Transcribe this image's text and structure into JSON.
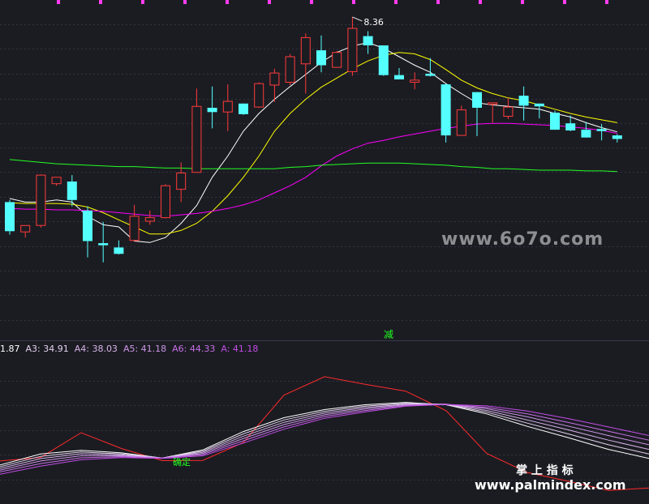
{
  "chart_data": [
    {
      "type": "candlestick",
      "title": "",
      "ylim": [
        3.8,
        8.6
      ],
      "grid": true,
      "high_label": "8.36",
      "signal_label": "减",
      "candles": [
        {
          "o": 5.75,
          "h": 5.78,
          "l": 5.29,
          "c": 5.34
        },
        {
          "o": 5.33,
          "h": 5.42,
          "l": 5.25,
          "c": 5.42
        },
        {
          "o": 5.42,
          "h": 6.14,
          "l": 5.39,
          "c": 6.13
        },
        {
          "o": 6.01,
          "h": 6.1,
          "l": 5.98,
          "c": 6.1
        },
        {
          "o": 6.04,
          "h": 6.13,
          "l": 5.69,
          "c": 5.78
        },
        {
          "o": 5.63,
          "h": 5.69,
          "l": 4.97,
          "c": 5.2
        },
        {
          "o": 5.17,
          "h": 5.47,
          "l": 4.9,
          "c": 5.14
        },
        {
          "o": 5.11,
          "h": 5.21,
          "l": 5.01,
          "c": 5.02
        },
        {
          "o": 5.21,
          "h": 5.71,
          "l": 5.2,
          "c": 5.55
        },
        {
          "o": 5.48,
          "h": 5.63,
          "l": 5.43,
          "c": 5.53
        },
        {
          "o": 5.53,
          "h": 6.0,
          "l": 5.52,
          "c": 5.98
        },
        {
          "o": 5.93,
          "h": 6.31,
          "l": 5.75,
          "c": 6.16
        },
        {
          "o": 6.17,
          "h": 7.35,
          "l": 6.17,
          "c": 7.1
        },
        {
          "o": 7.08,
          "h": 7.38,
          "l": 6.79,
          "c": 7.02
        },
        {
          "o": 7.02,
          "h": 7.41,
          "l": 6.75,
          "c": 7.17
        },
        {
          "o": 7.14,
          "h": 7.13,
          "l": 6.98,
          "c": 6.99
        },
        {
          "o": 7.09,
          "h": 7.44,
          "l": 7.08,
          "c": 7.42
        },
        {
          "o": 7.4,
          "h": 7.63,
          "l": 7.16,
          "c": 7.57
        },
        {
          "o": 7.44,
          "h": 7.84,
          "l": 7.4,
          "c": 7.8
        },
        {
          "o": 7.7,
          "h": 8.13,
          "l": 7.28,
          "c": 8.07
        },
        {
          "o": 7.89,
          "h": 8.1,
          "l": 7.58,
          "c": 7.68
        },
        {
          "o": 7.65,
          "h": 7.88,
          "l": 7.65,
          "c": 7.86
        },
        {
          "o": 7.59,
          "h": 8.36,
          "l": 7.53,
          "c": 8.2
        },
        {
          "o": 8.09,
          "h": 8.16,
          "l": 7.84,
          "c": 7.96
        },
        {
          "o": 7.96,
          "h": 7.88,
          "l": 7.53,
          "c": 7.54
        },
        {
          "o": 7.54,
          "h": 7.64,
          "l": 7.49,
          "c": 7.48
        },
        {
          "o": 7.44,
          "h": 7.58,
          "l": 7.34,
          "c": 7.47
        },
        {
          "o": 7.56,
          "h": 7.78,
          "l": 7.52,
          "c": 7.53
        },
        {
          "o": 7.41,
          "h": 7.42,
          "l": 6.59,
          "c": 6.69
        },
        {
          "o": 6.69,
          "h": 7.11,
          "l": 6.69,
          "c": 7.05
        },
        {
          "o": 7.3,
          "h": 7.3,
          "l": 6.68,
          "c": 7.08
        },
        {
          "o": 7.13,
          "h": 7.12,
          "l": 6.87,
          "c": 7.15
        },
        {
          "o": 6.96,
          "h": 7.22,
          "l": 6.92,
          "c": 7.09
        },
        {
          "o": 7.25,
          "h": 7.38,
          "l": 6.9,
          "c": 7.11
        },
        {
          "o": 7.14,
          "h": 7.14,
          "l": 6.93,
          "c": 7.1
        },
        {
          "o": 7.01,
          "h": 7.04,
          "l": 6.88,
          "c": 6.77
        },
        {
          "o": 6.86,
          "h": 6.97,
          "l": 6.75,
          "c": 6.76
        },
        {
          "o": 6.77,
          "h": 6.88,
          "l": 6.68,
          "c": 6.66
        },
        {
          "o": 6.78,
          "h": 6.85,
          "l": 6.62,
          "c": 6.75
        },
        {
          "o": 6.69,
          "h": 6.71,
          "l": 6.59,
          "c": 6.64
        }
      ],
      "series": [
        {
          "color": "#ffffff",
          "values": [
            5.8,
            5.75,
            5.75,
            5.78,
            5.75,
            5.55,
            5.43,
            5.4,
            5.2,
            5.18,
            5.25,
            5.45,
            5.7,
            6.1,
            6.4,
            6.75,
            7.0,
            7.2,
            7.38,
            7.55,
            7.72,
            7.86,
            7.95,
            8.0,
            7.92,
            7.8,
            7.68,
            7.58,
            7.42,
            7.28,
            7.15,
            7.12,
            7.1,
            7.08,
            7.06,
            7.0,
            6.95,
            6.87,
            6.8,
            6.74
          ]
        },
        {
          "color": "#ffff00",
          "values": [
            5.74,
            5.73,
            5.73,
            5.73,
            5.72,
            5.68,
            5.6,
            5.5,
            5.4,
            5.3,
            5.3,
            5.35,
            5.45,
            5.62,
            5.84,
            6.1,
            6.4,
            6.75,
            7.0,
            7.2,
            7.37,
            7.5,
            7.63,
            7.74,
            7.82,
            7.86,
            7.84,
            7.76,
            7.62,
            7.47,
            7.36,
            7.28,
            7.22,
            7.18,
            7.12,
            7.06,
            7.0,
            6.95,
            6.91,
            6.87
          ]
        },
        {
          "color": "#ff00ff",
          "values": [
            5.66,
            5.65,
            5.65,
            5.64,
            5.64,
            5.63,
            5.62,
            5.6,
            5.58,
            5.56,
            5.55,
            5.57,
            5.59,
            5.62,
            5.66,
            5.71,
            5.78,
            5.88,
            5.98,
            6.1,
            6.26,
            6.4,
            6.5,
            6.58,
            6.62,
            6.67,
            6.71,
            6.75,
            6.79,
            6.82,
            6.85,
            6.86,
            6.86,
            6.85,
            6.84,
            6.83,
            6.81,
            6.79,
            6.76,
            6.72
          ]
        },
        {
          "color": "#22ff22",
          "values": [
            6.35,
            6.33,
            6.31,
            6.29,
            6.28,
            6.27,
            6.26,
            6.25,
            6.25,
            6.24,
            6.23,
            6.23,
            6.22,
            6.22,
            6.22,
            6.22,
            6.22,
            6.22,
            6.24,
            6.25,
            6.27,
            6.28,
            6.29,
            6.3,
            6.3,
            6.3,
            6.29,
            6.28,
            6.27,
            6.25,
            6.24,
            6.22,
            6.22,
            6.21,
            6.2,
            6.2,
            6.2,
            6.19,
            6.19,
            6.18
          ]
        }
      ]
    },
    {
      "type": "line",
      "title": "",
      "grid": true,
      "legend": [
        {
          "label": "1.87",
          "color": "#ffffff"
        },
        {
          "label": "A3: 34.91",
          "color": "#e4d2ee"
        },
        {
          "label": "A4: 38.03",
          "color": "#d8b4ea"
        },
        {
          "label": "A5: 41.18",
          "color": "#cc96e6"
        },
        {
          "label": "A6: 44.33",
          "color": "#c66fe6"
        },
        {
          "label": "A: 41.18",
          "color": "#c24de6"
        }
      ],
      "signal_label": "确定",
      "x": [
        0,
        50,
        100,
        150,
        200,
        250,
        300,
        350,
        400,
        450,
        500,
        550,
        600,
        650,
        700,
        750,
        800
      ],
      "series": [
        {
          "color": "#ff2a2a",
          "values": [
            13.8,
            15.0,
            23.6,
            18.1,
            13.9,
            14.0,
            20.2,
            36.6,
            43.0,
            40.4,
            38.0,
            31.2,
            16.4,
            9.8,
            6.8,
            3.6,
            4.4
          ]
        },
        {
          "color": "#ffffff",
          "values": [
            12.4,
            16.2,
            17.5,
            16.6,
            14.8,
            17.6,
            24.0,
            28.8,
            31.6,
            33.3,
            34.1,
            33.3,
            30.1,
            25.8,
            21.9,
            17.8,
            14.7
          ]
        },
        {
          "color": "#e4d2ee",
          "values": [
            11.8,
            15.4,
            16.9,
            16.2,
            14.8,
            17.2,
            23.2,
            28.0,
            31.0,
            32.8,
            33.8,
            33.4,
            30.7,
            26.9,
            23.2,
            19.4,
            16.2
          ]
        },
        {
          "color": "#d8b4ea",
          "values": [
            11.2,
            14.6,
            16.3,
            15.9,
            14.8,
            16.8,
            22.4,
            27.2,
            30.4,
            32.3,
            33.5,
            33.5,
            31.3,
            28.0,
            24.6,
            21.0,
            17.8
          ]
        },
        {
          "color": "#cc96e6",
          "values": [
            10.6,
            13.8,
            15.6,
            15.6,
            14.8,
            16.4,
            21.6,
            26.4,
            29.8,
            31.8,
            33.3,
            33.5,
            31.9,
            29.1,
            25.9,
            22.6,
            19.4
          ]
        },
        {
          "color": "#c66fe6",
          "values": [
            10.0,
            12.9,
            14.9,
            15.3,
            14.8,
            16.0,
            20.8,
            25.6,
            29.2,
            31.3,
            33.0,
            33.4,
            32.4,
            30.1,
            27.2,
            24.1,
            21.0
          ]
        },
        {
          "color": "#c24de6",
          "values": [
            9.2,
            12.0,
            14.2,
            15.0,
            14.7,
            15.6,
            20.0,
            24.8,
            28.6,
            30.8,
            32.8,
            33.4,
            32.9,
            31.1,
            28.5,
            25.6,
            22.6
          ]
        }
      ]
    }
  ],
  "watermarks": {
    "site_6070": "www.6o7o.com",
    "palm_title": "掌 上 指 标",
    "palm_url": "www.palmindex.com"
  }
}
